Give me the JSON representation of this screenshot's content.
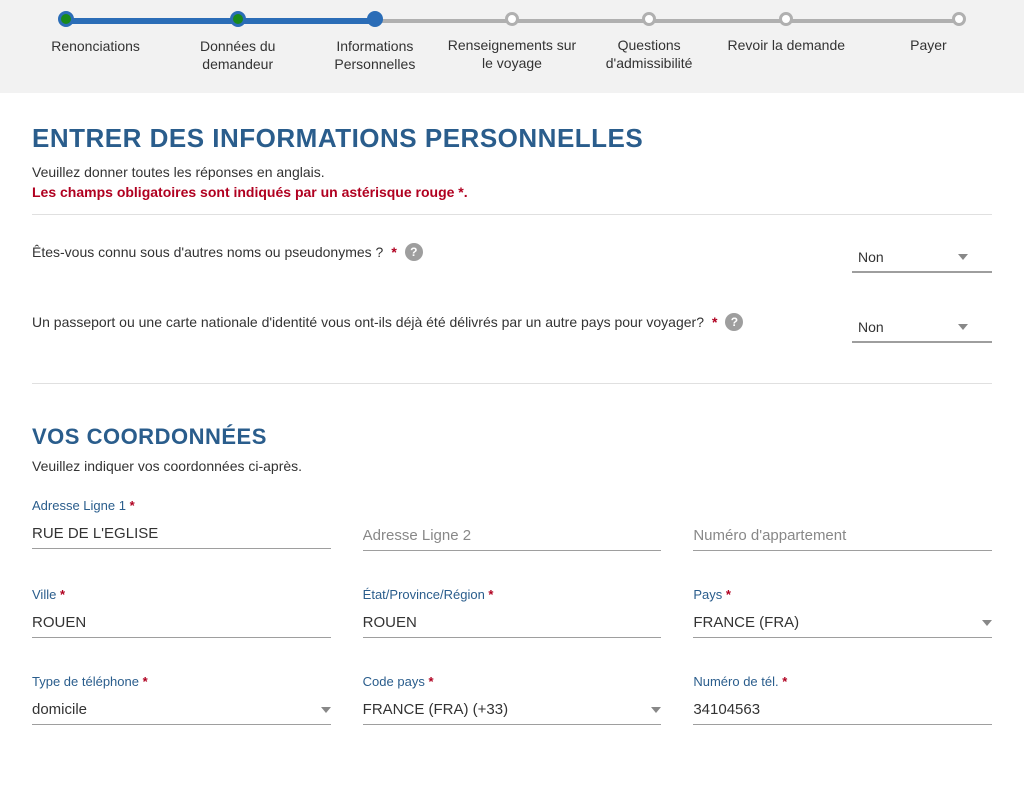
{
  "stepper": {
    "steps": [
      {
        "label": "Renonciations",
        "state": "done"
      },
      {
        "label": "Données du demandeur",
        "state": "done"
      },
      {
        "label": "Informations Personnelles",
        "state": "active"
      },
      {
        "label": "Renseignements sur le voyage",
        "state": "future"
      },
      {
        "label": "Questions d'admissibilité",
        "state": "future"
      },
      {
        "label": "Revoir la demande",
        "state": "future"
      },
      {
        "label": "Payer",
        "state": "future"
      }
    ]
  },
  "page": {
    "title": "ENTRER DES INFORMATIONS PERSONNELLES",
    "subtitle": "Veuillez donner toutes les réponses en anglais.",
    "required_note": "Les champs obligatoires sont indiqués par un astérisque rouge *."
  },
  "questions": {
    "aliases": {
      "text": "Êtes-vous connu sous d'autres noms ou pseudonymes ?",
      "value": "Non"
    },
    "passport_other_country": {
      "text": "Un passeport ou une carte nationale d'identité vous ont-ils déjà été délivrés par un autre pays pour voyager?",
      "value": "Non"
    }
  },
  "contact": {
    "title": "VOS COORDONNÉES",
    "subtitle": "Veuillez indiquer vos coordonnées ci-après.",
    "address1": {
      "label": "Adresse Ligne 1",
      "value": "RUE DE L'EGLISE"
    },
    "address2": {
      "placeholder": "Adresse Ligne 2",
      "value": ""
    },
    "apt": {
      "placeholder": "Numéro d'appartement",
      "value": ""
    },
    "city": {
      "label": "Ville",
      "value": "ROUEN"
    },
    "state": {
      "label": "État/Province/Région",
      "value": "ROUEN"
    },
    "country": {
      "label": "Pays",
      "value": "FRANCE (FRA)"
    },
    "phone_type": {
      "label": "Type de téléphone",
      "value": "domicile"
    },
    "country_code": {
      "label": "Code pays",
      "value": "FRANCE (FRA) (+33)"
    },
    "phone_number": {
      "label": "Numéro de tél.",
      "value": "34104563"
    }
  }
}
